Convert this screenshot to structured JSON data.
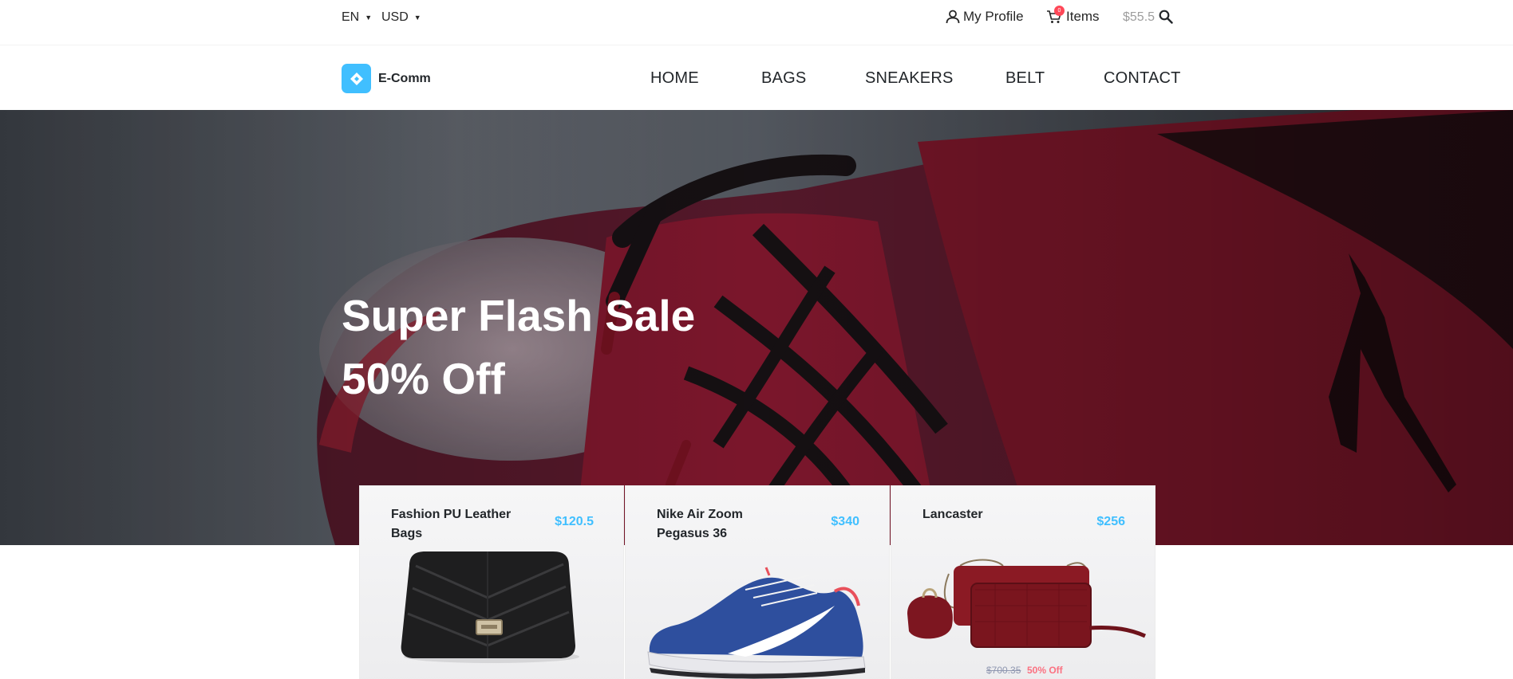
{
  "topbar": {
    "language": "EN",
    "currency": "USD",
    "profile_label": "My Profile",
    "cart_label": "Items",
    "cart_count": "0",
    "cart_total": "$55.5"
  },
  "brand": {
    "name": "E-Comm"
  },
  "nav": {
    "items": [
      "HOME",
      "BAGS",
      "SNEAKERS",
      "BELT",
      "CONTACT"
    ]
  },
  "hero": {
    "title": "Super Flash Sale",
    "subtitle": "50% Off"
  },
  "products": [
    {
      "name": "Fashion PU Leather Bags",
      "price": "$120.5"
    },
    {
      "name": "Nike Air Zoom Pegasus 36",
      "price": "$340"
    },
    {
      "name": "Lancaster",
      "price": "$256",
      "old_price": "$700.35",
      "discount": "50% Off"
    }
  ],
  "colors": {
    "accent": "#40bfff",
    "badge": "#ff4858",
    "discount": "#fb7181",
    "text": "#22262a"
  },
  "icons": {
    "profile": "user-icon",
    "cart": "cart-icon",
    "search": "search-icon",
    "logo": "diamond-logo-icon"
  }
}
